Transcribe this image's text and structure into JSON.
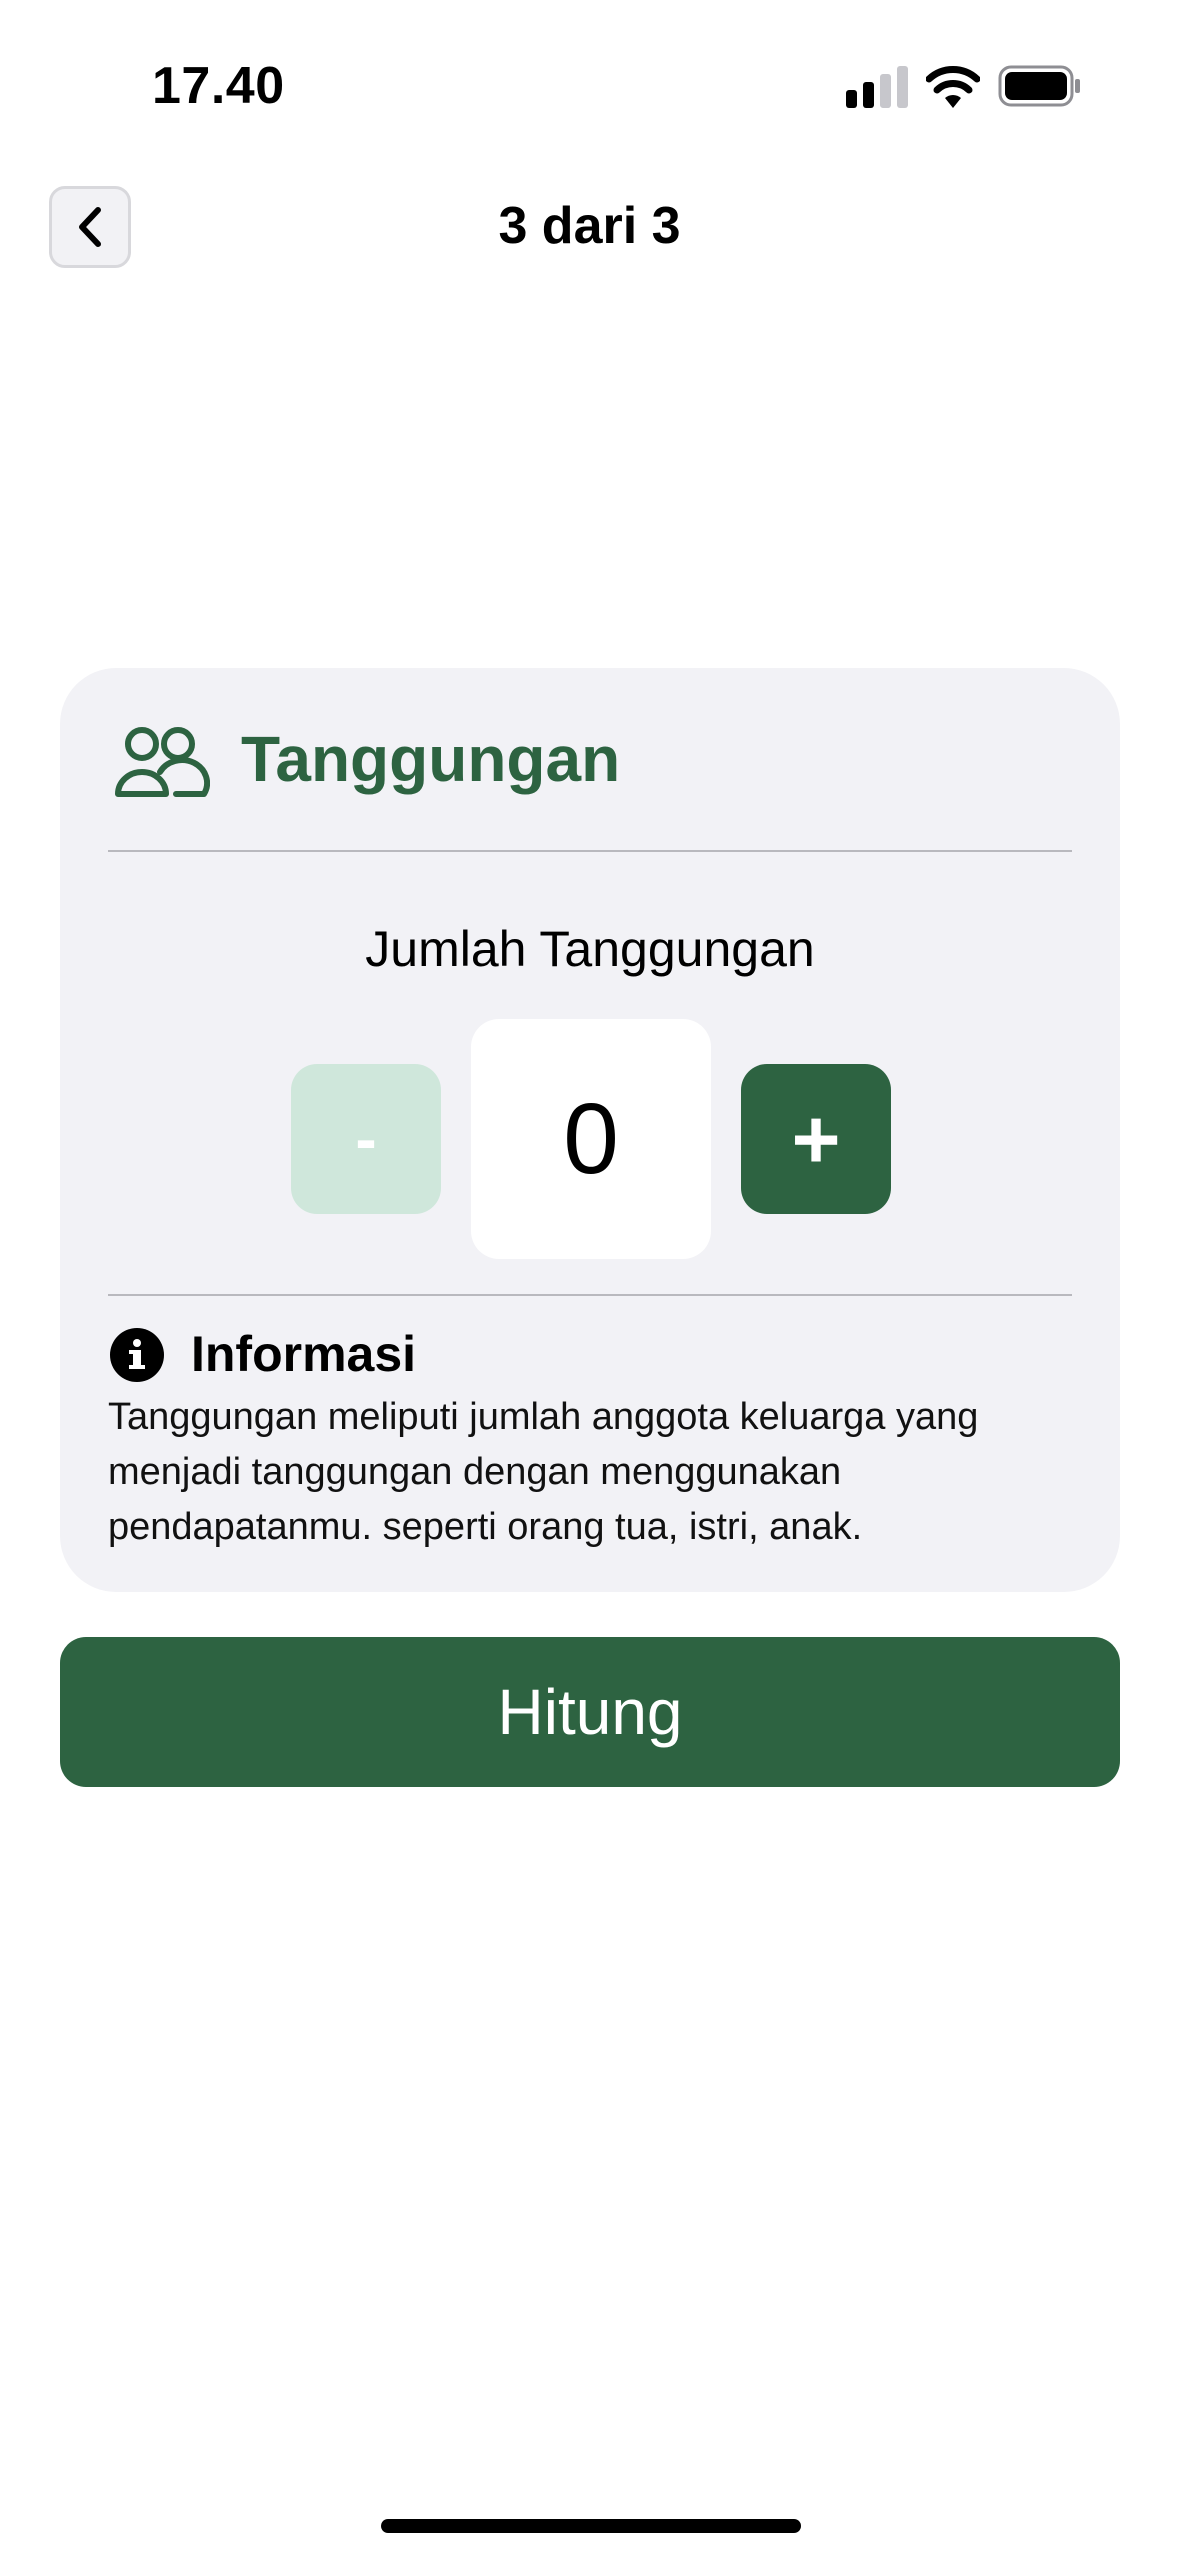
{
  "status_bar": {
    "time": "17.40"
  },
  "nav": {
    "title": "3 dari 3",
    "back_icon": "chevron-left-icon"
  },
  "card": {
    "title": "Tanggungan",
    "icon": "people-icon",
    "colors": {
      "accent": "#2d6341",
      "minus_disabled_bg": "#cfe7db",
      "card_bg": "#f2f2f6"
    },
    "field_label": "Jumlah Tanggungan",
    "minus_label": "-",
    "value": "0",
    "plus_label": "+",
    "info": {
      "icon": "info-icon",
      "title": "Informasi",
      "text": "Tanggungan meliputi jumlah anggota keluarga yang menjadi tanggungan dengan menggunakan pendapatanmu. seperti orang tua, istri, anak."
    }
  },
  "primary_button": {
    "label": "Hitung"
  }
}
